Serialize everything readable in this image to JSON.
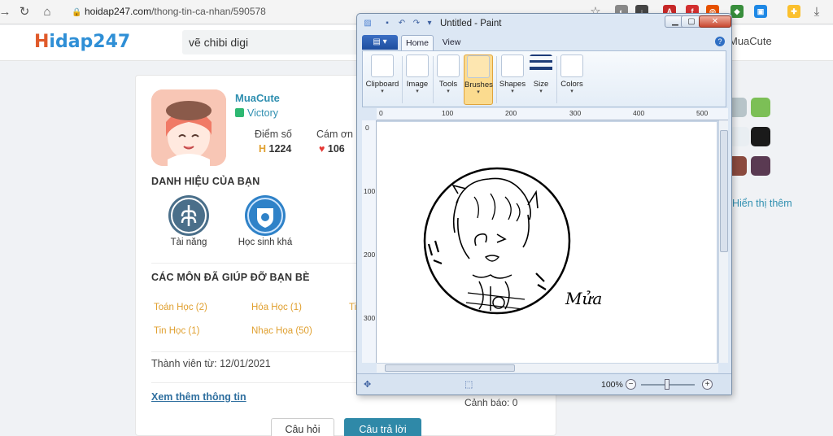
{
  "browser": {
    "url_host": "hoidap247.com",
    "url_path": "/thong-tin-ca-nhan/590578"
  },
  "site": {
    "logo_first": "H",
    "logo_rest": "idap247",
    "search_value": "vẽ chibi digi",
    "header_user": "MuaCute"
  },
  "profile": {
    "username": "MuaCute",
    "rank": "Victory",
    "points_label": "Điểm số",
    "points_value": "1224",
    "thanks_label": "Cám ơn",
    "thanks_value": "106"
  },
  "titles": {
    "heading": "DANH HIỆU CỦA BẠN",
    "badges": [
      {
        "label": "Tài năng"
      },
      {
        "label": "Học sinh khá"
      }
    ]
  },
  "subjects": {
    "heading": "CÁC MÔN ĐÃ GIÚP ĐỠ BẠN BÈ",
    "items": [
      {
        "name": "Toán Học (2)"
      },
      {
        "name": "Hóa Học (1)"
      },
      {
        "name": "Ti"
      },
      {
        "name": "Tin Học (1)"
      },
      {
        "name": "Nhạc Họa (50)"
      }
    ]
  },
  "member_since": "Thành viên từ: 12/01/2021",
  "more_info": "Xem thêm thông tin",
  "warning": "Cảnh báo: 0",
  "buttons": {
    "question": "Câu hỏi",
    "answer": "Câu trả lời"
  },
  "sidebar": {
    "show_more": "Hiển thị thêm"
  },
  "paint": {
    "title": "Untitled - Paint",
    "tabs": [
      "Home",
      "View"
    ],
    "ribbon": [
      "Clipboard",
      "Image",
      "Tools",
      "Brushes",
      "Shapes",
      "Size",
      "Colors"
    ],
    "ruler_top": [
      "0",
      "100",
      "200",
      "300",
      "400",
      "500"
    ],
    "ruler_left": [
      "0",
      "100",
      "200",
      "300"
    ],
    "zoom": "100%",
    "signature": "Mửa"
  },
  "colors": {
    "brand_blue": "#2f8fb0",
    "answer_btn": "#2f89a8",
    "subject_orange": "#e0a030",
    "ribbon_selected": "#fbdb8f"
  }
}
